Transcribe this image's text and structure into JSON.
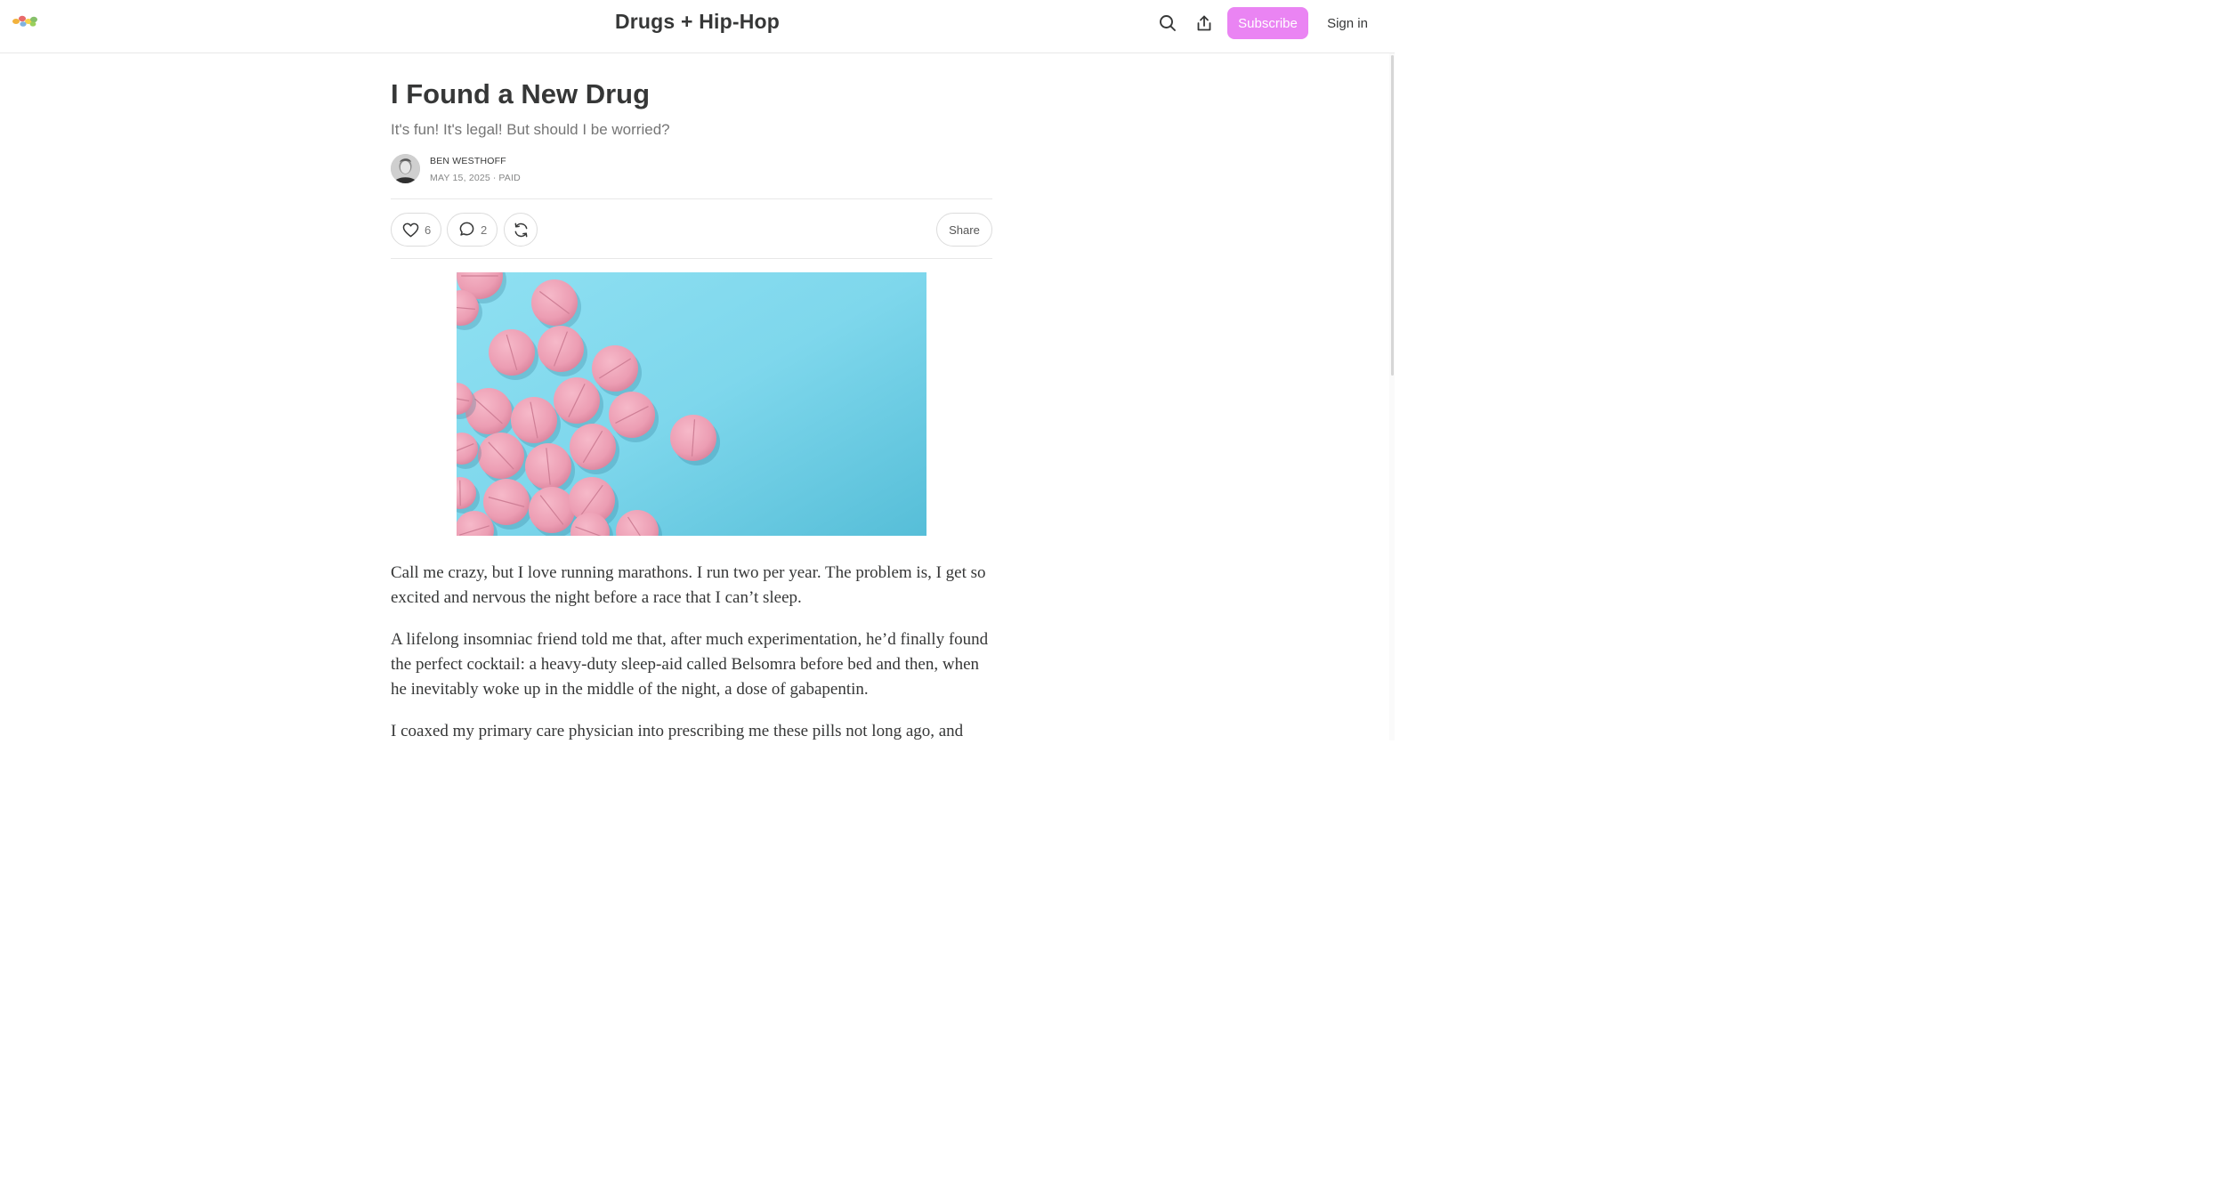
{
  "header": {
    "publication_title": "Drugs + Hip-Hop",
    "logo_icon": "pills-logo-icon",
    "search_icon": "search-icon",
    "share_icon": "upload-share-icon",
    "subscribe_label": "Subscribe",
    "signin_label": "Sign in",
    "accent_color": "#ea84f3"
  },
  "post": {
    "title": "I Found a New Drug",
    "subtitle": "It's fun! It's legal! But should I be worried?",
    "author": "BEN WESTHOFF",
    "meta": "MAY 15, 2025 ∙ PAID",
    "likes": "6",
    "comments": "2",
    "share_label": "Share",
    "hero_image": "pink-pills-on-blue-background",
    "paragraphs": [
      "Call me crazy, but I love running marathons. I run two per year. The problem is, I get so excited and nervous the night before a race that I can’t sleep.",
      "A lifelong insomniac friend told me that, after much experimentation, he’d finally found the perfect cocktail: a heavy-duty sleep-aid called Belsomra before bed and then, when he inevitably woke up in the middle of the night, a dose of gabapentin.",
      "I coaxed my primary care physician into prescribing me these pills not long ago, and"
    ]
  }
}
